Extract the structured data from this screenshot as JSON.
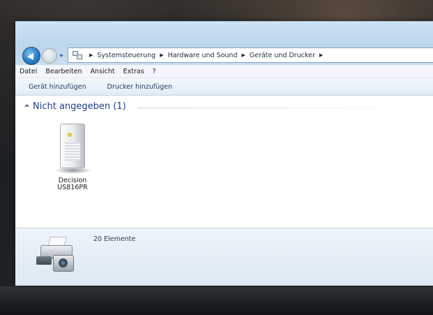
{
  "address_bar": {
    "crumbs": [
      "Systemsteuerung",
      "Hardware und Sound",
      "Geräte und Drucker"
    ],
    "separator": "▶"
  },
  "menu": [
    "Datei",
    "Bearbeiten",
    "Ansicht",
    "Extras",
    "?"
  ],
  "toolbar": [
    "Gerät hinzufügen",
    "Drucker hinzufügen"
  ],
  "group": {
    "title": "Nicht angegeben (1)"
  },
  "devices": [
    {
      "line1": "Decision",
      "line2": "US816PR",
      "icon": "tower-printer-icon"
    }
  ],
  "details": {
    "text": "20 Elemente",
    "icon": "printer-camera-icon"
  },
  "colors": {
    "accent": "#1e3f8a",
    "chrome": "#bcd6ec"
  }
}
